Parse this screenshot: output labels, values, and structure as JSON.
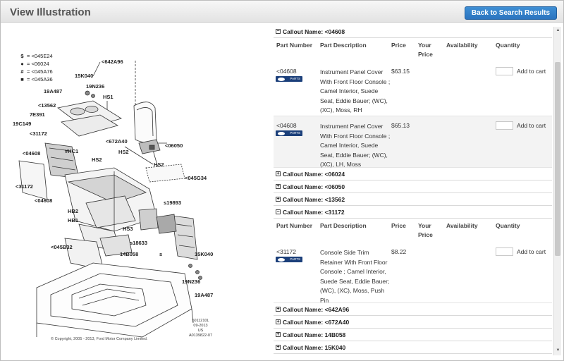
{
  "header": {
    "title": "View Illustration",
    "back_label": "Back to Search Results"
  },
  "legend": [
    {
      "symbol": "$",
      "text": "= <045E24"
    },
    {
      "symbol": "●",
      "text": "= <06024"
    },
    {
      "symbol": "#",
      "text": "= <045A76"
    },
    {
      "symbol": "■",
      "text": "= <045A36"
    }
  ],
  "labels": {
    "l642A96": "<642A96",
    "l15K040a": "15K040",
    "l19A487a": "19A487",
    "l19N236a": "19N236",
    "lHS1": "HS1",
    "l13562": "<13562",
    "l7E391": "7E391",
    "l19C149": "19C149",
    "l31172a": "<31172",
    "l672A40": "<672A40",
    "l06050": "<06050",
    "l04608a": "<04608",
    "lHC1": "#HC1",
    "lHS2a": "HS2",
    "lHS2b": "HS2",
    "lHS2c": "HS2",
    "l045G34": "<045G34",
    "l31172b": "<31172",
    "l04608b": "<04608",
    "ls19893": "s19893",
    "lHB2": "HB2",
    "lHB1": "HB1",
    "lHS3": "HS3",
    "ls18633": "s18633",
    "l045B32": "<045B32",
    "l14B058": "14B058",
    "lS": "s",
    "l15K040b": "15K040",
    "l19N236b": "19N236",
    "l19A487b": "19A487"
  },
  "doc_id": [
    "5011210L",
    "09-2013",
    "US",
    "A0139822-07"
  ],
  "copyright": "© Copyright, 2005 - 2013, Ford Motor Company Limited.",
  "columns": [
    "Part Number",
    "Part Description",
    "Price",
    "Your Price",
    "Availability",
    "Quantity"
  ],
  "callouts_top": [
    {
      "sign": "−",
      "name": "Callout Name: <04608"
    }
  ],
  "parts_04608": [
    {
      "pn": "<04608",
      "desc": "Instrument Panel Cover With Front Floor Console ; Camel Interior, Suede Seat, Eddie Bauer; (WC), (XC), Moss, RH",
      "price": "$63.15",
      "add": "Add to cart"
    },
    {
      "pn": "<04608",
      "desc": "Instrument Panel Cover With Front Floor Console ; Camel Interior, Suede Seat, Eddie Bauer; (WC), (XC), LH, Moss",
      "price": "$65.13",
      "add": "Add to cart"
    }
  ],
  "callouts_mid": [
    {
      "sign": "+",
      "name": "Callout Name: <06024"
    },
    {
      "sign": "+",
      "name": "Callout Name: <06050"
    },
    {
      "sign": "+",
      "name": "Callout Name: <13562"
    },
    {
      "sign": "−",
      "name": "Callout Name: <31172"
    }
  ],
  "parts_31172": [
    {
      "pn": "<31172",
      "desc": "Console Side Trim Retainer With Front Floor Console ; Camel Interior, Suede Seat, Eddie Bauer; (WC), (XC), Moss, Push Pin",
      "price": "$8.22",
      "add": "Add to cart"
    }
  ],
  "callouts_bottom": [
    {
      "sign": "+",
      "name": "Callout Name: <642A96"
    },
    {
      "sign": "+",
      "name": "Callout Name: <672A40"
    },
    {
      "sign": "+",
      "name": "Callout Name: 14B058"
    },
    {
      "sign": "+",
      "name": "Callout Name: 15K040"
    }
  ],
  "logo_text": "PARTS",
  "scroll": {
    "up": "▲",
    "down": "▼"
  }
}
